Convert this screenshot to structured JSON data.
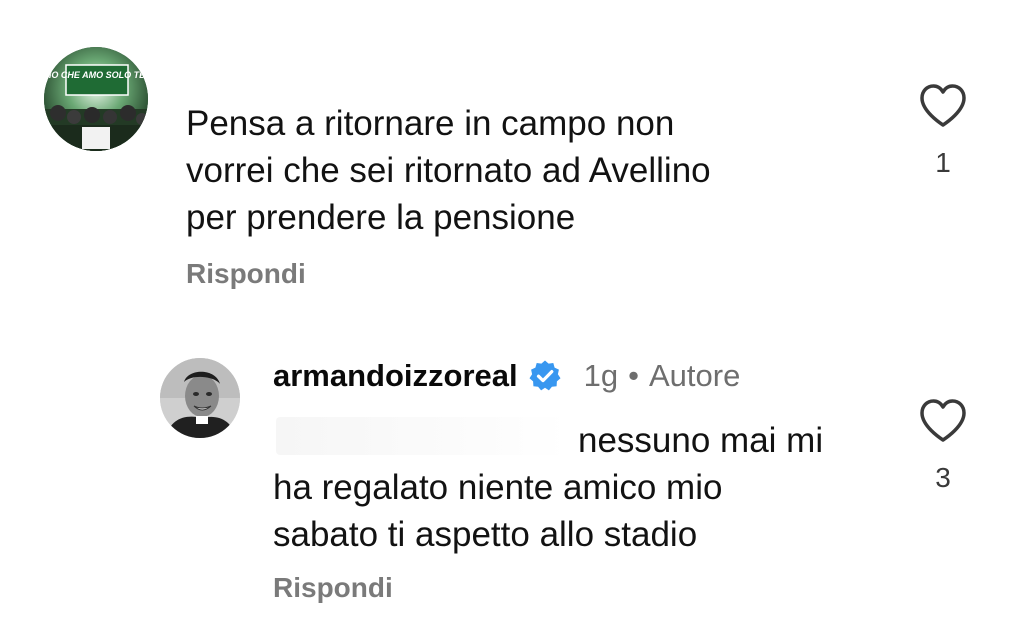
{
  "comments": [
    {
      "avatar_icon": "fan-group-avatar",
      "avatar_banner_text": "IO CHE AMO SOLO TE",
      "text_lines": [
        "Pensa a ritornare in campo non",
        "vorrei che sei ritornato ad Avellino",
        "per prendere la pensione"
      ],
      "reply_label": "Rispondi",
      "like_icon": "heart-outline-icon",
      "like_count": "1"
    }
  ],
  "reply": {
    "avatar_icon": "user-photo-avatar",
    "username": "armandoizzoreal",
    "verified_icon": "verified-badge-icon",
    "verified_color": "#3897f0",
    "time": "1g",
    "separator": "•",
    "author_label": "Autore",
    "text_lines": [
      "nessuno mai mi",
      "ha regalato niente amico mio",
      "sabato ti aspetto allo stadio"
    ],
    "reply_label": "Rispondi",
    "like_icon": "heart-outline-icon",
    "like_count": "3"
  }
}
